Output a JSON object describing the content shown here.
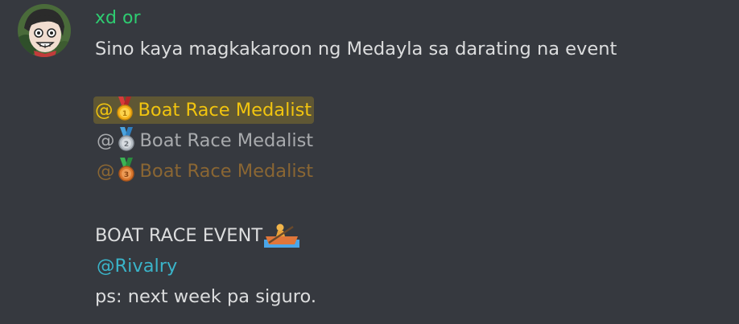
{
  "message": {
    "username": "xd or",
    "username_color": "#2ecc71",
    "avatar_icon": "anime-face-avatar",
    "line1": "Sino kaya magkakaroon ng Medayla sa darating na event",
    "mentions": [
      {
        "at": "@",
        "medal_icon": "gold-medal-icon",
        "label": "Boat Race Medalist",
        "color": "#f1c40f",
        "highlighted": true,
        "bg": "rgba(241, 196, 15, 0.22)"
      },
      {
        "at": "@",
        "medal_icon": "silver-medal-icon",
        "label": "Boat Race Medalist",
        "color": "#a8aaad",
        "highlighted": false
      },
      {
        "at": "@",
        "medal_icon": "bronze-medal-icon",
        "label": "Boat Race Medalist",
        "color": "#8a6633",
        "highlighted": false
      }
    ],
    "event_line": "BOAT RACE EVENT",
    "event_icon": "rowboat-emoji-icon",
    "rivalry_mention": "@Rivalry",
    "rivalry_color": "#3ab4c9",
    "ps_line": "ps: next week pa siguro."
  }
}
